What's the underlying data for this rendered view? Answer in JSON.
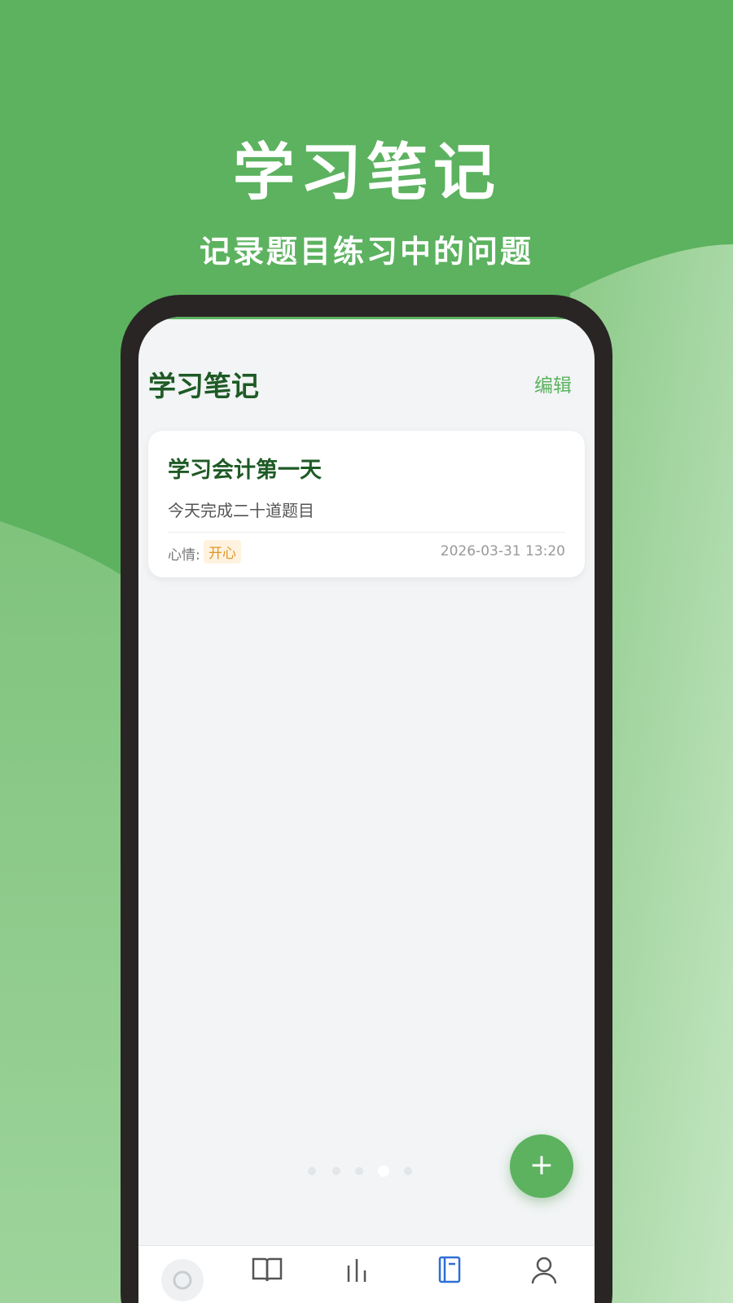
{
  "hero": {
    "title": "学习笔记",
    "subtitle": "记录题目练习中的问题"
  },
  "app": {
    "page_title": "学习笔记",
    "edit_label": "编辑",
    "notes": [
      {
        "title": "学习会计第一天",
        "body": "今天完成二十道题目",
        "mood_label": "心情:",
        "mood": "开心",
        "time": "2026-03-31 13:20"
      }
    ],
    "add_button_label": "+",
    "carousel": {
      "count": 5,
      "active_index": 3
    },
    "tabs": [
      {
        "icon": "home-icon",
        "active": false
      },
      {
        "icon": "book-icon",
        "active": false
      },
      {
        "icon": "stats-icon",
        "active": false
      },
      {
        "icon": "notebook-icon",
        "active": true
      },
      {
        "icon": "user-icon",
        "active": false
      }
    ]
  },
  "colors": {
    "brand_green": "#5cb25f",
    "title_green": "#1e5a25",
    "mood_orange": "#e0962a",
    "tab_active": "#2f6fd6",
    "tab_inactive": "#555555"
  }
}
